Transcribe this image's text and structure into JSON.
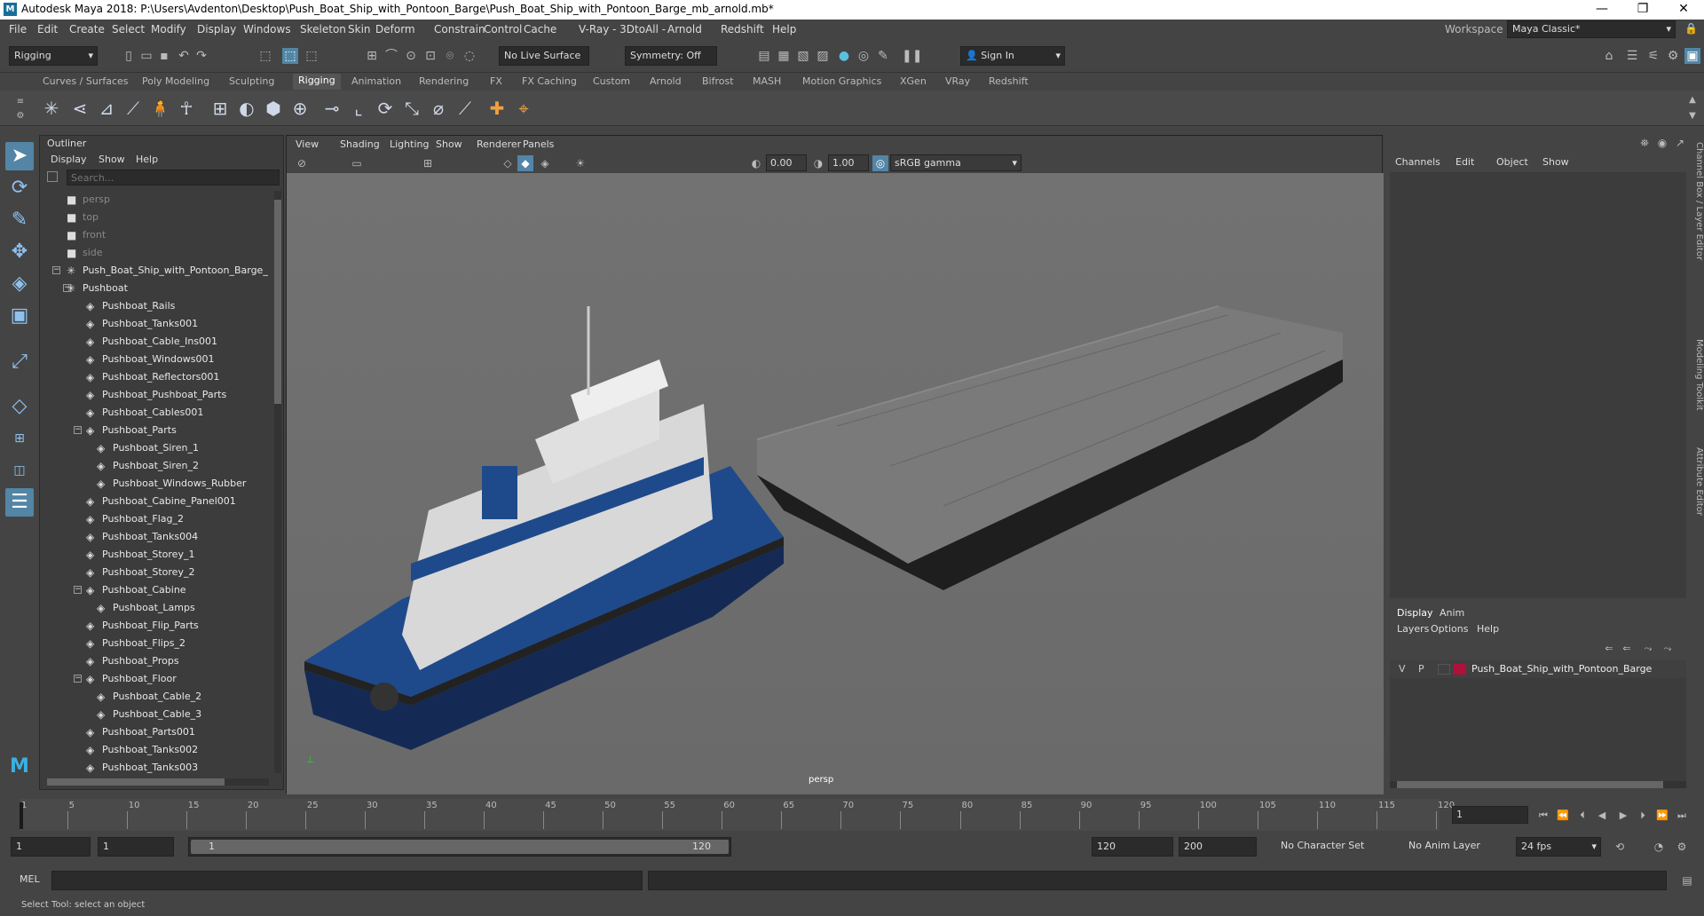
{
  "app": {
    "title": "Autodesk Maya 2018: P:\\Users\\Avdenton\\Desktop\\Push_Boat_Ship_with_Pontoon_Barge\\Push_Boat_Ship_with_Pontoon_Barge_mb_arnold.mb*",
    "logo": "M"
  },
  "window_controls": {
    "minimize": "—",
    "maximize": "❐",
    "close": "✕"
  },
  "menu": [
    "File",
    "Edit",
    "Create",
    "Select",
    "Modify",
    "Display",
    "Windows",
    "Skeleton",
    "Skin",
    "Deform",
    "Constrain",
    "Control",
    "Cache",
    "V-Ray",
    "- 3DtoAll -",
    "Arnold",
    "Redshift",
    "Help"
  ],
  "workspace": {
    "label": "Workspace :",
    "value": "Maya Classic*"
  },
  "status": {
    "mode": "Rigging",
    "live_surface": "No Live Surface",
    "symmetry": "Symmetry: Off",
    "sign_in": "Sign In"
  },
  "shelf_tabs": [
    "Curves / Surfaces",
    "Poly Modeling",
    "Sculpting",
    "Rigging",
    "Animation",
    "Rendering",
    "FX",
    "FX Caching",
    "Custom",
    "Arnold",
    "Bifrost",
    "MASH",
    "Motion Graphics",
    "XGen",
    "VRay",
    "Redshift"
  ],
  "active_shelf": "Rigging",
  "outliner": {
    "title": "Outliner",
    "menu": [
      "Display",
      "Show",
      "Help"
    ],
    "search_placeholder": "Search...",
    "items": [
      {
        "label": "persp",
        "type": "cam",
        "depth": 0
      },
      {
        "label": "top",
        "type": "cam",
        "depth": 0
      },
      {
        "label": "front",
        "type": "cam",
        "depth": 0
      },
      {
        "label": "side",
        "type": "cam",
        "depth": 0
      },
      {
        "label": "Push_Boat_Ship_with_Pontoon_Barge_",
        "type": "grp",
        "depth": 0,
        "exp": "−"
      },
      {
        "label": "Pushboat",
        "type": "grp",
        "depth": 1,
        "exp": "−"
      },
      {
        "label": "Pushboat_Rails",
        "type": "mesh",
        "depth": 2
      },
      {
        "label": "Pushboat_Tanks001",
        "type": "mesh",
        "depth": 2
      },
      {
        "label": "Pushboat_Cable_Ins001",
        "type": "mesh",
        "depth": 2
      },
      {
        "label": "Pushboat_Windows001",
        "type": "mesh",
        "depth": 2
      },
      {
        "label": "Pushboat_Reflectors001",
        "type": "mesh",
        "depth": 2
      },
      {
        "label": "Pushboat_Pushboat_Parts",
        "type": "mesh",
        "depth": 2
      },
      {
        "label": "Pushboat_Cables001",
        "type": "mesh",
        "depth": 2
      },
      {
        "label": "Pushboat_Parts",
        "type": "mesh",
        "depth": 2,
        "exp": "−"
      },
      {
        "label": "Pushboat_Siren_1",
        "type": "mesh",
        "depth": 3
      },
      {
        "label": "Pushboat_Siren_2",
        "type": "mesh",
        "depth": 3
      },
      {
        "label": "Pushboat_Windows_Rubber",
        "type": "mesh",
        "depth": 3
      },
      {
        "label": "Pushboat_Cabine_Panel001",
        "type": "mesh",
        "depth": 2
      },
      {
        "label": "Pushboat_Flag_2",
        "type": "mesh",
        "depth": 2
      },
      {
        "label": "Pushboat_Tanks004",
        "type": "mesh",
        "depth": 2
      },
      {
        "label": "Pushboat_Storey_1",
        "type": "mesh",
        "depth": 2
      },
      {
        "label": "Pushboat_Storey_2",
        "type": "mesh",
        "depth": 2
      },
      {
        "label": "Pushboat_Cabine",
        "type": "mesh",
        "depth": 2,
        "exp": "−"
      },
      {
        "label": "Pushboat_Lamps",
        "type": "mesh",
        "depth": 3
      },
      {
        "label": "Pushboat_Flip_Parts",
        "type": "mesh",
        "depth": 2
      },
      {
        "label": "Pushboat_Flips_2",
        "type": "mesh",
        "depth": 2
      },
      {
        "label": "Pushboat_Props",
        "type": "mesh",
        "depth": 2
      },
      {
        "label": "Pushboat_Floor",
        "type": "mesh",
        "depth": 2,
        "exp": "−"
      },
      {
        "label": "Pushboat_Cable_2",
        "type": "mesh",
        "depth": 3
      },
      {
        "label": "Pushboat_Cable_3",
        "type": "mesh",
        "depth": 3
      },
      {
        "label": "Pushboat_Parts001",
        "type": "mesh",
        "depth": 2
      },
      {
        "label": "Pushboat_Tanks002",
        "type": "mesh",
        "depth": 2
      },
      {
        "label": "Pushboat_Tanks003",
        "type": "mesh",
        "depth": 2
      }
    ]
  },
  "viewport": {
    "menu": [
      "View",
      "Shading",
      "Lighting",
      "Show",
      "Renderer",
      "Panels"
    ],
    "near": "0.00",
    "far": "1.00",
    "color_space": "sRGB gamma",
    "camera_label": "persp"
  },
  "channel_box": {
    "menu": [
      "Channels",
      "Edit",
      "Object",
      "Show"
    ],
    "layer_tabs": [
      "Display",
      "Anim"
    ],
    "layer_menu": [
      "Layers",
      "Options",
      "Help"
    ],
    "layer": {
      "v": "V",
      "p": "P",
      "name": "Push_Boat_Ship_with_Pontoon_Barge",
      "color": "#b0113a"
    },
    "side_tabs": [
      "Channel Box / Layer Editor",
      "Modeling Toolkit",
      "Attribute Editor"
    ]
  },
  "timeline": {
    "ticks": [
      "1",
      "5",
      "10",
      "15",
      "20",
      "25",
      "30",
      "35",
      "40",
      "45",
      "50",
      "55",
      "60",
      "65",
      "70",
      "75",
      "80",
      "85",
      "90",
      "95",
      "100",
      "105",
      "110",
      "115",
      "120"
    ],
    "current": "1"
  },
  "range": {
    "start": "1",
    "inner_start": "1",
    "slider_start": "1",
    "slider_end": "120",
    "end": "120",
    "max": "200",
    "char_set": "No Character Set",
    "anim_layer": "No Anim Layer",
    "fps": "24 fps"
  },
  "cmd": {
    "lang": "MEL"
  },
  "help_line": "Select Tool: select an object",
  "colors": {
    "accent": "#5285a6",
    "bg": "#444444"
  }
}
